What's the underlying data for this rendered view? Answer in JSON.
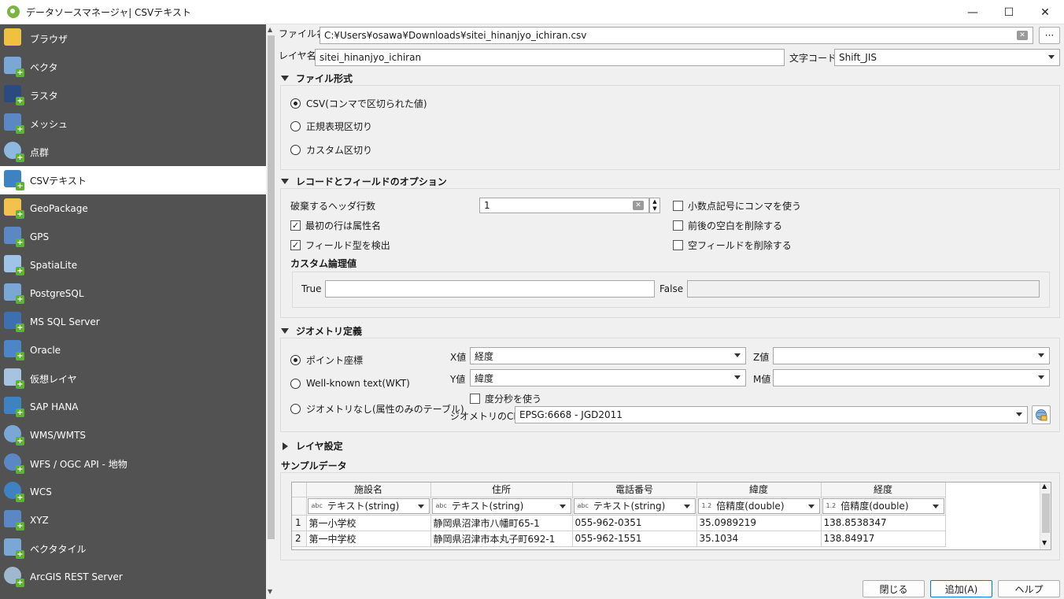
{
  "window": {
    "title": "データソースマネージャ| CSVテキスト",
    "minimize": "—",
    "maximize": "☐",
    "close": "✕"
  },
  "sidebar": {
    "items": [
      {
        "label": "ブラウザ",
        "icon": "folder-icon"
      },
      {
        "label": "ベクタ",
        "icon": "vector-icon"
      },
      {
        "label": "ラスタ",
        "icon": "raster-icon"
      },
      {
        "label": "メッシュ",
        "icon": "mesh-icon"
      },
      {
        "label": "点群",
        "icon": "point-cloud-icon"
      },
      {
        "label": "CSVテキスト",
        "icon": "csv-icon"
      },
      {
        "label": "GeoPackage",
        "icon": "geopackage-icon"
      },
      {
        "label": "GPS",
        "icon": "gps-icon"
      },
      {
        "label": "SpatiaLite",
        "icon": "spatialite-icon"
      },
      {
        "label": "PostgreSQL",
        "icon": "postgresql-icon"
      },
      {
        "label": "MS SQL Server",
        "icon": "mssql-icon"
      },
      {
        "label": "Oracle",
        "icon": "oracle-icon"
      },
      {
        "label": "仮想レイヤ",
        "icon": "virtual-layer-icon"
      },
      {
        "label": "SAP HANA",
        "icon": "sap-hana-icon"
      },
      {
        "label": "WMS/WMTS",
        "icon": "wms-icon"
      },
      {
        "label": "WFS / OGC API - 地物",
        "icon": "wfs-icon"
      },
      {
        "label": "WCS",
        "icon": "wcs-icon"
      },
      {
        "label": "XYZ",
        "icon": "xyz-icon"
      },
      {
        "label": "ベクタタイル",
        "icon": "vector-tile-icon"
      },
      {
        "label": "ArcGIS REST Server",
        "icon": "arcgis-icon"
      }
    ],
    "active_index": 5
  },
  "file": {
    "label": "ファイル名",
    "value": "C:¥Users¥osawa¥Downloads¥sitei_hinanjyo_ichiran.csv",
    "browse": "···"
  },
  "layer": {
    "label": "レイヤ名",
    "value": "sitei_hinanjyo_ichiran",
    "encoding_label": "文字コード",
    "encoding_value": "Shift_JIS"
  },
  "file_format": {
    "title": "ファイル形式",
    "options": [
      "CSV(コンマで区切られた値)",
      "正規表現区切り",
      "カスタム区切り"
    ],
    "selected": 0
  },
  "record_options": {
    "title": "レコードとフィールドのオプション",
    "discard_label": "破棄するヘッダ行数",
    "discard_value": "1",
    "first_row_names": "最初の行は属性名",
    "detect_types": "フィールド型を検出",
    "decimal_comma": "小数点記号にコンマを使う",
    "trim": "前後の空白を削除する",
    "discard_empty": "空フィールドを削除する",
    "custom_bool_title": "カスタム論理値",
    "true_label": "True",
    "false_label": "False",
    "true_value": "",
    "false_value": "",
    "check_mark": "✓"
  },
  "geometry": {
    "title": "ジオメトリ定義",
    "options": [
      "ポイント座標",
      "Well-known text(WKT)",
      "ジオメトリなし(属性のみのテーブル)"
    ],
    "selected": 0,
    "x_label": "X値",
    "x_value": "経度",
    "y_label": "Y値",
    "y_value": "緯度",
    "z_label": "Z値",
    "z_value": "",
    "m_label": "M値",
    "m_value": "",
    "dms_label": "度分秒を使う",
    "crs_label": "ジオメトリのCRS",
    "crs_value": "EPSG:6668 - JGD2011"
  },
  "layer_settings": {
    "title": "レイヤ設定"
  },
  "sample": {
    "title": "サンプルデータ",
    "columns": [
      "施設名",
      "住所",
      "電話番号",
      "緯度",
      "経度"
    ],
    "types": [
      {
        "tag": "abc",
        "label": "テキスト(string)"
      },
      {
        "tag": "abc",
        "label": "テキスト(string)"
      },
      {
        "tag": "abc",
        "label": "テキスト(string)"
      },
      {
        "tag": "1.2",
        "label": "倍精度(double)"
      },
      {
        "tag": "1.2",
        "label": "倍精度(double)"
      }
    ],
    "rows": [
      {
        "num": "1",
        "cells": [
          "第一小学校",
          "静岡県沼津市八幡町65-1",
          "055-962-0351",
          "35.0989219",
          "138.8538347"
        ]
      },
      {
        "num": "2",
        "cells": [
          "第一中学校",
          "静岡県沼津市本丸子町692-1",
          "055-962-1551",
          "35.1034",
          "138.84917"
        ]
      }
    ]
  },
  "buttons": {
    "close": "閉じる",
    "add": "追加(A)",
    "help": "ヘルプ"
  }
}
